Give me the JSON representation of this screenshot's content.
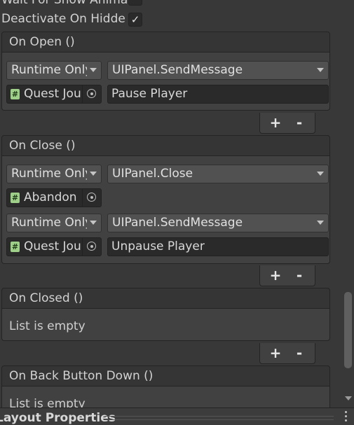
{
  "fields": {
    "wait_for_show_animation": {
      "label": "Wait For Show Anima",
      "checked": false
    },
    "deactivate_on_hidden": {
      "label": "Deactivate On Hidde",
      "checked": true,
      "check_glyph": "✓"
    }
  },
  "events": {
    "on_open": {
      "header": "On Open ()",
      "listeners": [
        {
          "mode": "Runtime Only",
          "function": "UIPanel.SendMessage",
          "target": "Quest Journal",
          "argument": "Pause Player"
        }
      ]
    },
    "on_close": {
      "header": "On Close ()",
      "listeners": [
        {
          "mode": "Runtime Only",
          "function": "UIPanel.Close",
          "target": "Abandon"
        },
        {
          "mode": "Runtime Only",
          "function": "UIPanel.SendMessage",
          "target": "Quest Journal",
          "argument": "Unpause Player"
        }
      ]
    },
    "on_closed": {
      "header": "On Closed ()",
      "empty_text": "List is empty"
    },
    "on_back_button_down": {
      "header": "On Back Button Down ()",
      "empty_text": "List is empty"
    }
  },
  "buttons": {
    "add": "+",
    "remove": "-"
  },
  "icons": {
    "script_icon": "#",
    "object_picker": "object-picker-icon",
    "dropdown_arrow": "dropdown-arrow-icon"
  },
  "footer": {
    "section_title": "Layout Properties"
  },
  "colors": {
    "background": "#383838",
    "field": "#2a2a2a",
    "dropdown": "#515151",
    "script_icon": "#9fd089"
  }
}
